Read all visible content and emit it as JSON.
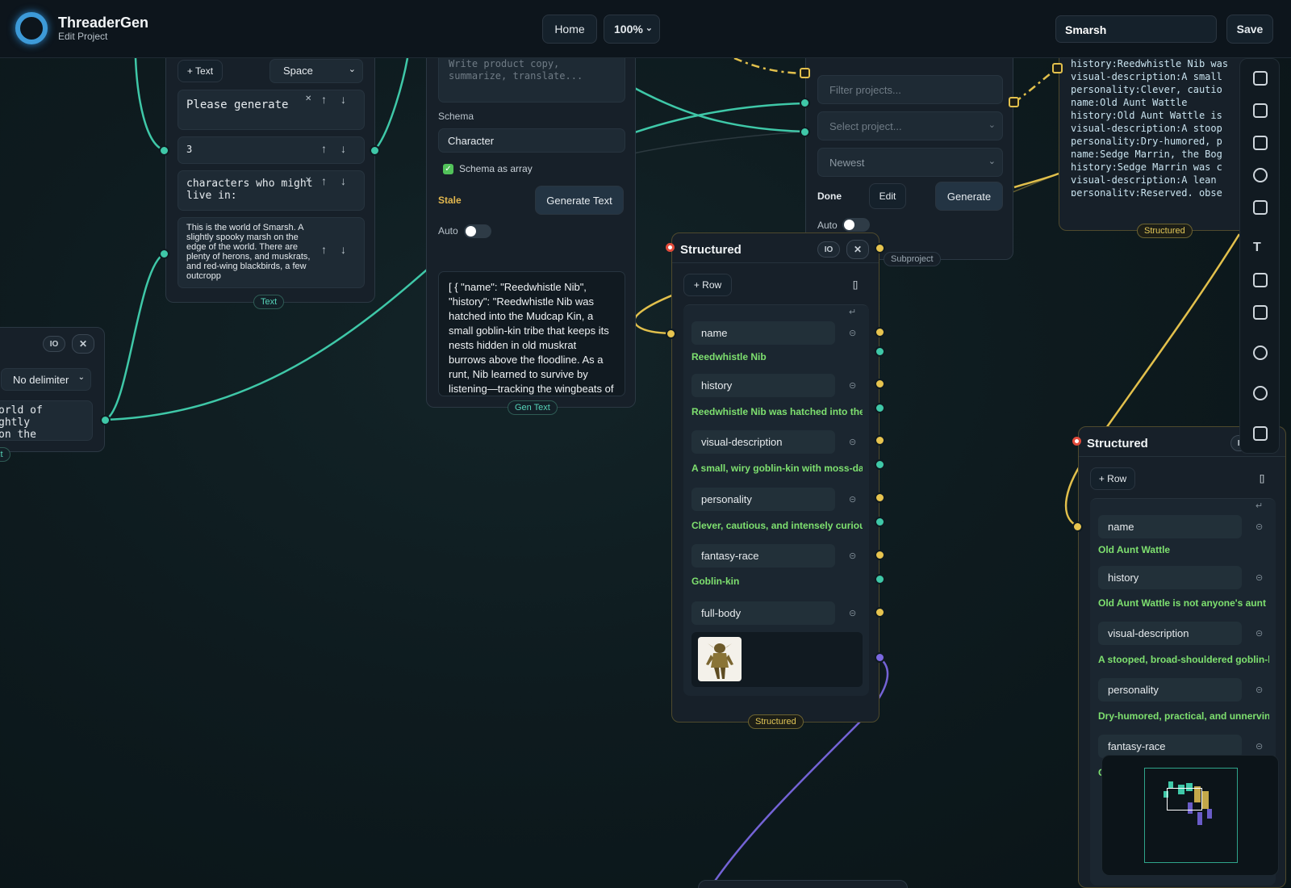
{
  "app": {
    "name": "ThreaderGen",
    "subtitle": "Edit Project"
  },
  "header": {
    "home_label": "Home",
    "zoom_value": "100%",
    "project_name": "Smarsh",
    "save_label": "Save"
  },
  "text_node": {
    "add_text_label": "+ Text",
    "delimiter_select": "Space",
    "parts": [
      "Please generate",
      "3",
      "characters who might live in:",
      "This is the world of Smarsh. A slightly spooky marsh on the edge of the world. There are plenty of herons, and muskrats, and red-wing blackbirds, a few outcropp"
    ],
    "tag": "Text"
  },
  "left_node": {
    "io_label": "IO",
    "delimiter_select": "No delimiter",
    "text_preview": "orld of\nghtly\non the",
    "tag": "xt"
  },
  "gen_text_node": {
    "prompt_placeholder": "Write product copy, summarize, translate...",
    "schema_label": "Schema",
    "schema_value": "Character",
    "schema_as_array_label": "Schema as array",
    "status": "Stale",
    "generate_label": "Generate Text",
    "auto_label": "Auto",
    "output": "[ { \"name\": \"Reedwhistle Nib\", \"history\": \"Reedwhistle Nib was hatched into the Mudcap Kin, a small goblin-kin tribe that keeps its nests hidden in old muskrat burrows above the floodline. As a runt, Nib learned to survive by listening—tracking the wingbeats of",
    "tag": "Gen Text"
  },
  "subproject_node": {
    "filter_placeholder": "Filter projects...",
    "select_placeholder": "Select project...",
    "sort_value": "Newest",
    "status": "Done",
    "edit_label": "Edit",
    "generate_label": "Generate",
    "auto_label": "Auto",
    "tag": "Subproject"
  },
  "preview_node": {
    "lines": [
      "history:Reedwhistle Nib was",
      "visual-description:A small",
      "personality:Clever, cautio",
      "name:Old Aunt Wattle",
      "history:Old Aunt Wattle is",
      "visual-description:A stoop",
      "personality:Dry-humored, p",
      "name:Sedge Marrin, the Bog",
      "history:Sedge Marrin was c",
      "visual-description:A lean",
      "personality:Reserved, obse"
    ],
    "tag": "Structured"
  },
  "structured_1": {
    "title": "Structured",
    "io_label": "IO",
    "add_row_label": "+ Row",
    "rows": [
      {
        "name": "name",
        "value": "Reedwhistle Nib"
      },
      {
        "name": "history",
        "value": "Reedwhistle Nib was hatched into the Mudcap Kin"
      },
      {
        "name": "visual-description",
        "value": "A small, wiry goblin-kin with moss-dark"
      },
      {
        "name": "personality",
        "value": "Clever, cautious, and intensely curious."
      },
      {
        "name": "fantasy-race",
        "value": "Goblin-kin"
      },
      {
        "name": "full-body",
        "value": ""
      }
    ],
    "tag": "Structured"
  },
  "structured_2": {
    "title": "Structured",
    "io_label": "IO",
    "add_row_label": "+ Row",
    "rows": [
      {
        "name": "name",
        "value": "Old Aunt Wattle"
      },
      {
        "name": "history",
        "value": "Old Aunt Wattle is not anyone's aunt by"
      },
      {
        "name": "visual-description",
        "value": "A stooped, broad-shouldered goblin-kin"
      },
      {
        "name": "personality",
        "value": "Dry-humored, practical, and unnervingl"
      },
      {
        "name": "fantasy-race",
        "value": "G"
      }
    ]
  },
  "toolbar_icons": [
    "text-node-icon",
    "image-node-icon",
    "video-node-icon",
    "settings-sliders-icon",
    "folder-icon",
    "typography-icon",
    "image-gallery-icon",
    "image-edit-icon",
    "comment-icon",
    "audio-icon",
    "code-icon"
  ],
  "colors": {
    "teal_wire": "#3fc8a8",
    "yellow_wire": "#e2c04c",
    "purple_wire": "#7463d6",
    "value_green": "#7ee06f"
  }
}
